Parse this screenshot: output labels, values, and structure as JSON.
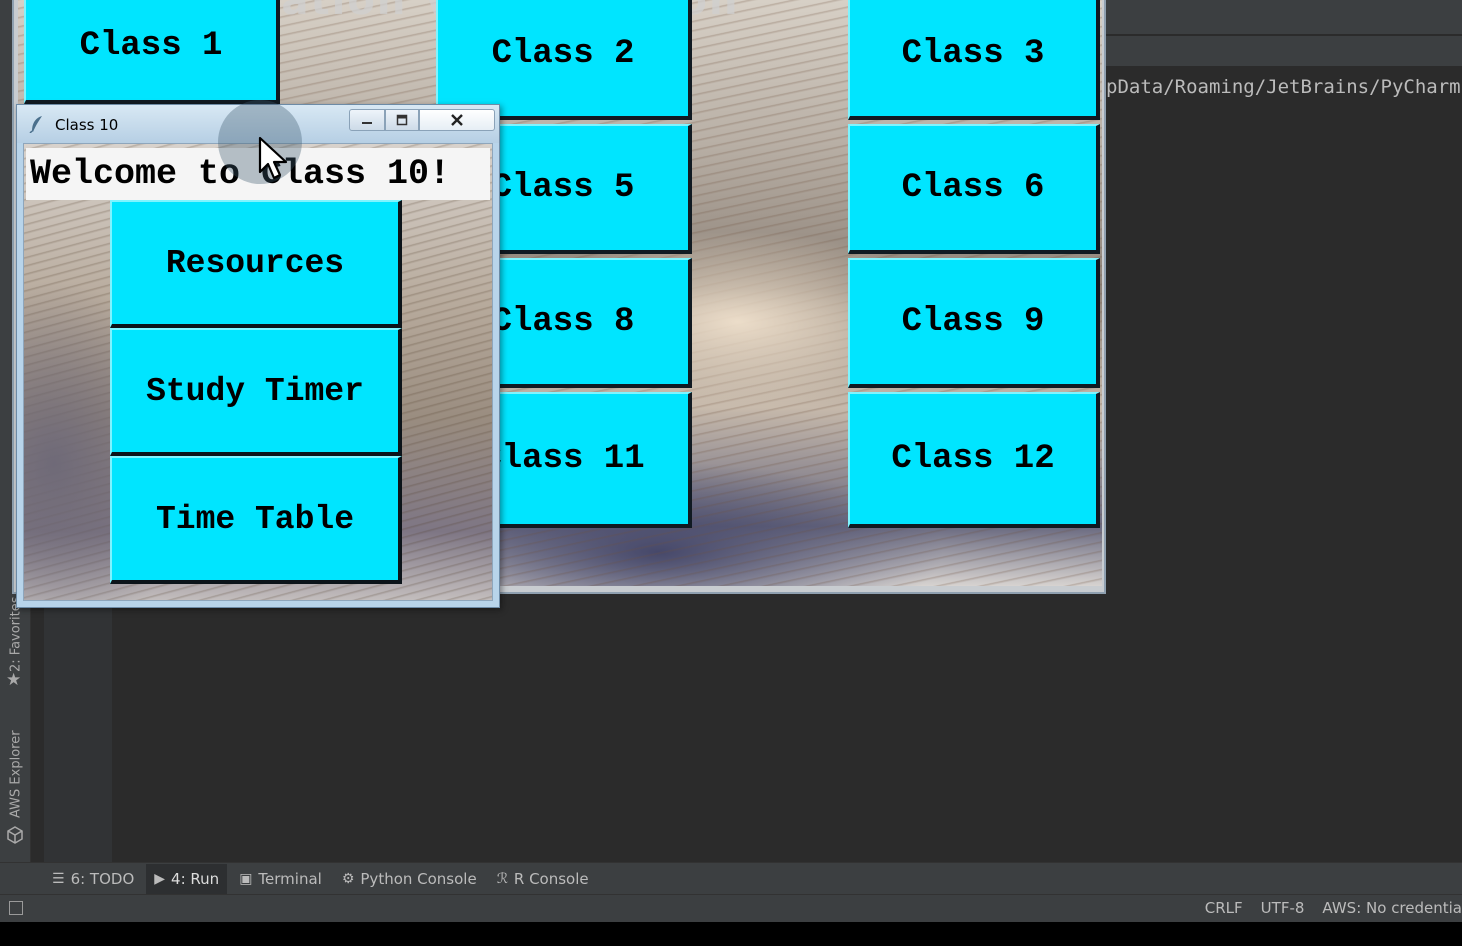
{
  "ide": {
    "path_text": "pData/Roaming/JetBrains/PyCharm",
    "left_tabs": {
      "favorites": "2: Favorites",
      "aws_explorer": "AWS Explorer"
    },
    "bottom_tabs": [
      {
        "icon": "list-icon",
        "glyph": "☰",
        "label": "6: TODO"
      },
      {
        "icon": "run-icon",
        "glyph": "▶",
        "label": "4: Run"
      },
      {
        "icon": "terminal-icon",
        "glyph": "▣",
        "label": "Terminal"
      },
      {
        "icon": "python-icon",
        "glyph": "⚙",
        "label": "Python Console"
      },
      {
        "icon": "r-console-icon",
        "glyph": "ℛ",
        "label": "R Console"
      }
    ],
    "status": {
      "line_sep": "CRLF",
      "encoding": "UTF-8",
      "aws": "AWS: No credentia"
    }
  },
  "main_window": {
    "title_fragment": "Virtualisation Visualisation",
    "classes": [
      "Class 1",
      "Class 2",
      "Class 3",
      "Class 5",
      "Class 6",
      "Class 8",
      "Class 9",
      "Class 11",
      "Class 12"
    ]
  },
  "child_window": {
    "title": "Class 10",
    "welcome": "Welcome to Class 10!",
    "buttons": [
      "Resources",
      "Study Timer",
      "Time Table"
    ]
  },
  "colors": {
    "button_cyan": "#00e5ff",
    "ide_dark": "#2b2b2b",
    "ide_panel": "#3c3f41"
  }
}
